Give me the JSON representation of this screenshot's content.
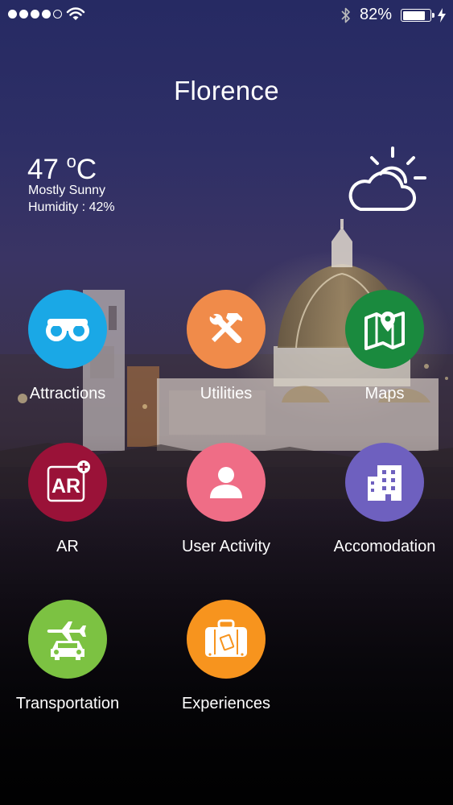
{
  "status_bar": {
    "signal_bars_filled": 4,
    "signal_bars_total": 5,
    "battery_percent_text": "82%",
    "battery_level": 0.82
  },
  "city": "Florence",
  "weather": {
    "temperature_value": "47",
    "temperature_unit": "C",
    "unit_prefix": "o",
    "condition": "Mostly Sunny",
    "humidity": "Humidity : 42%",
    "icon": "partly-cloudy-icon"
  },
  "tiles": [
    {
      "label": "Attractions",
      "color": "#1aa8e6",
      "icon": "binoculars-icon"
    },
    {
      "label": "Utilities",
      "color": "#f08b4a",
      "icon": "tools-icon"
    },
    {
      "label": "Maps",
      "color": "#1a8a3e",
      "icon": "map-pin-icon"
    },
    {
      "label": "AR",
      "color": "#9a1238",
      "icon": "ar-plus-icon"
    },
    {
      "label": "User Activity",
      "color": "#ef6d86",
      "icon": "user-icon"
    },
    {
      "label": "Accomodation",
      "color": "#6e60bf",
      "icon": "building-icon"
    },
    {
      "label": "Transportation",
      "color": "#7cc242",
      "icon": "plane-car-icon"
    },
    {
      "label": "Experiences",
      "color": "#f7941e",
      "icon": "suitcase-icon"
    }
  ]
}
